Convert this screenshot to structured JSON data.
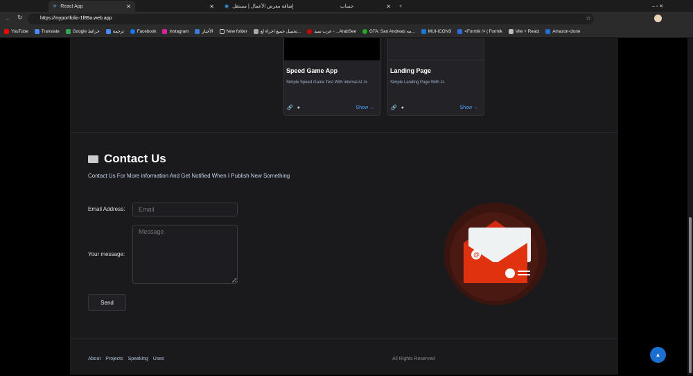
{
  "browser": {
    "tabs": [
      {
        "label": "React App",
        "active": true
      },
      {
        "label": ""
      },
      {
        "label": "إضافة معرض الأعمال | مستقل"
      },
      {
        "label": "حساب"
      }
    ],
    "url": "https://myportfolio-1f89a.web.app",
    "bookmarks": [
      "YouTube",
      "Translate",
      "Google خرائط",
      "ترجمة",
      "Facebook",
      "Instagram",
      "الأخبار",
      "New folder",
      "تحميل جميع اجزاء لع...",
      "عرب سيد - ...ArabSee",
      "GTA: San Andreas مه...",
      "MUI-ICONS",
      "<Formik /> | Formik",
      "Vite + React",
      "Amazon-clone"
    ]
  },
  "projects": [
    {
      "title": "Speed Game App",
      "description": "Simple Speed Game Test With interval At Js",
      "show": "Show"
    },
    {
      "title": "Landing Page",
      "description": "Simple Landing Page With Js",
      "show": "Show"
    }
  ],
  "contact": {
    "title": "Contact Us",
    "subtitle": "Contact Us For More information And Get Notified When I Publish New Something",
    "email_label": "Email Address:",
    "email_placeholder": "Email",
    "message_label": "Your message:",
    "message_placeholder": "Message",
    "send": "Send"
  },
  "footer": {
    "links": [
      "About",
      "Projects",
      "Speaking",
      "Uses"
    ],
    "rights": "All Rights Reserved"
  },
  "colors": {
    "accent": "#4aa3ff",
    "envelope": "#d42a10",
    "scroll_top": "#1a6fd0"
  }
}
